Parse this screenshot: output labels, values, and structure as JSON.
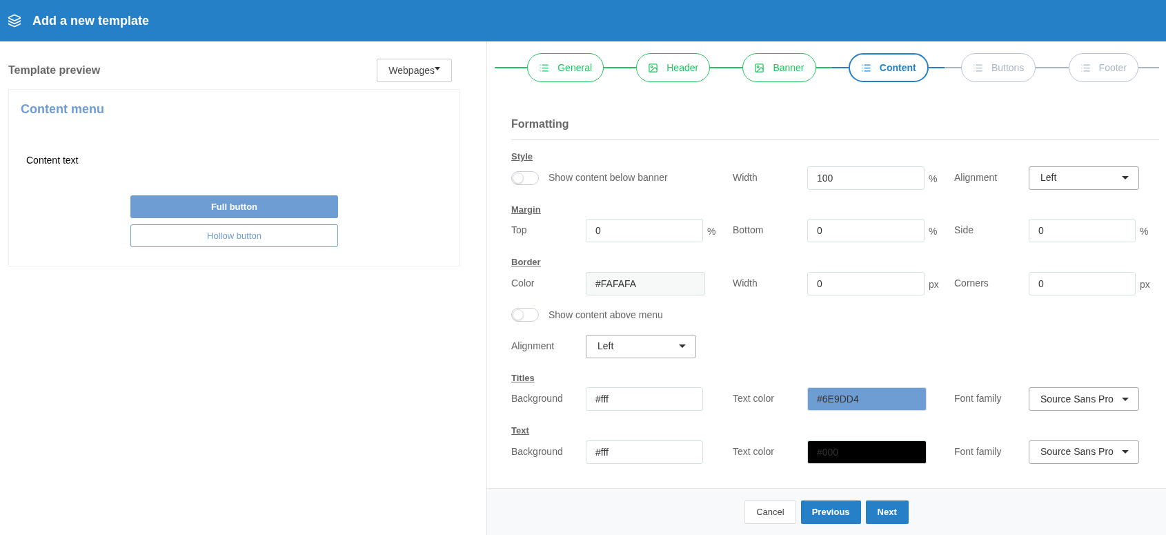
{
  "header": {
    "title": "Add a new template"
  },
  "preview": {
    "title": "Template preview",
    "dropdown": "Webpages",
    "menu_title": "Content menu",
    "content_text": "Content text",
    "full_button": "Full button",
    "hollow_button": "Hollow button"
  },
  "steps": [
    {
      "label": "General",
      "kind": "list",
      "completed": true,
      "selected": false
    },
    {
      "label": "Header",
      "kind": "image",
      "completed": true,
      "selected": false
    },
    {
      "label": "Banner",
      "kind": "image",
      "completed": true,
      "selected": false
    },
    {
      "label": "Content",
      "kind": "list",
      "completed": false,
      "selected": true
    },
    {
      "label": "Buttons",
      "kind": "list",
      "completed": false,
      "selected": false
    },
    {
      "label": "Footer",
      "kind": "list",
      "completed": false,
      "selected": false
    }
  ],
  "formatting": {
    "heading": "Formatting",
    "groups": [
      {
        "title": "Style",
        "rows": [
          [
            {
              "kind": "toggle",
              "label": "Show content below banner",
              "on": false
            },
            {
              "kind": "input",
              "label": "Width",
              "value": "100",
              "unit": "%"
            },
            {
              "kind": "select",
              "label": "Alignment",
              "value": "Left"
            }
          ]
        ]
      },
      {
        "title": "Margin",
        "rows": [
          [
            {
              "kind": "input",
              "label": "Top",
              "value": "0",
              "unit": "%"
            },
            {
              "kind": "input",
              "label": "Bottom",
              "value": "0",
              "unit": "%"
            },
            {
              "kind": "input",
              "label": "Side",
              "value": "0",
              "unit": "%"
            }
          ]
        ]
      },
      {
        "title": "Border",
        "rows": [
          [
            {
              "kind": "swatch",
              "label": "Color",
              "value": "#FAFAFA",
              "color": "#f7f8f8"
            },
            {
              "kind": "input",
              "label": "Width",
              "value": "0",
              "unit": "px"
            },
            {
              "kind": "input",
              "label": "Corners",
              "value": "0",
              "unit": "px"
            }
          ],
          [
            {
              "kind": "toggle",
              "label": "Show content above menu",
              "on": false
            }
          ],
          [
            {
              "kind": "select",
              "label": "Alignment",
              "value": "Left"
            }
          ]
        ]
      },
      {
        "title": "Titles",
        "rows": [
          [
            {
              "kind": "input",
              "label": "Background",
              "value": "#fff"
            },
            {
              "kind": "swatch",
              "label": "Text color",
              "value": "#6E9DD4",
              "color": "#6e9dd4"
            },
            {
              "kind": "select",
              "label": "Font family",
              "value": "Source Sans Pro"
            }
          ]
        ]
      },
      {
        "title": "Text",
        "rows": [
          [
            {
              "kind": "input",
              "label": "Background",
              "value": "#fff"
            },
            {
              "kind": "swatch",
              "label": "Text color",
              "value": "#000",
              "color": "#000000"
            },
            {
              "kind": "select",
              "label": "Font family",
              "value": "Source Sans Pro"
            }
          ]
        ]
      }
    ]
  },
  "footer": {
    "buttons": [
      "Cancel",
      "Previous",
      "Next"
    ]
  }
}
